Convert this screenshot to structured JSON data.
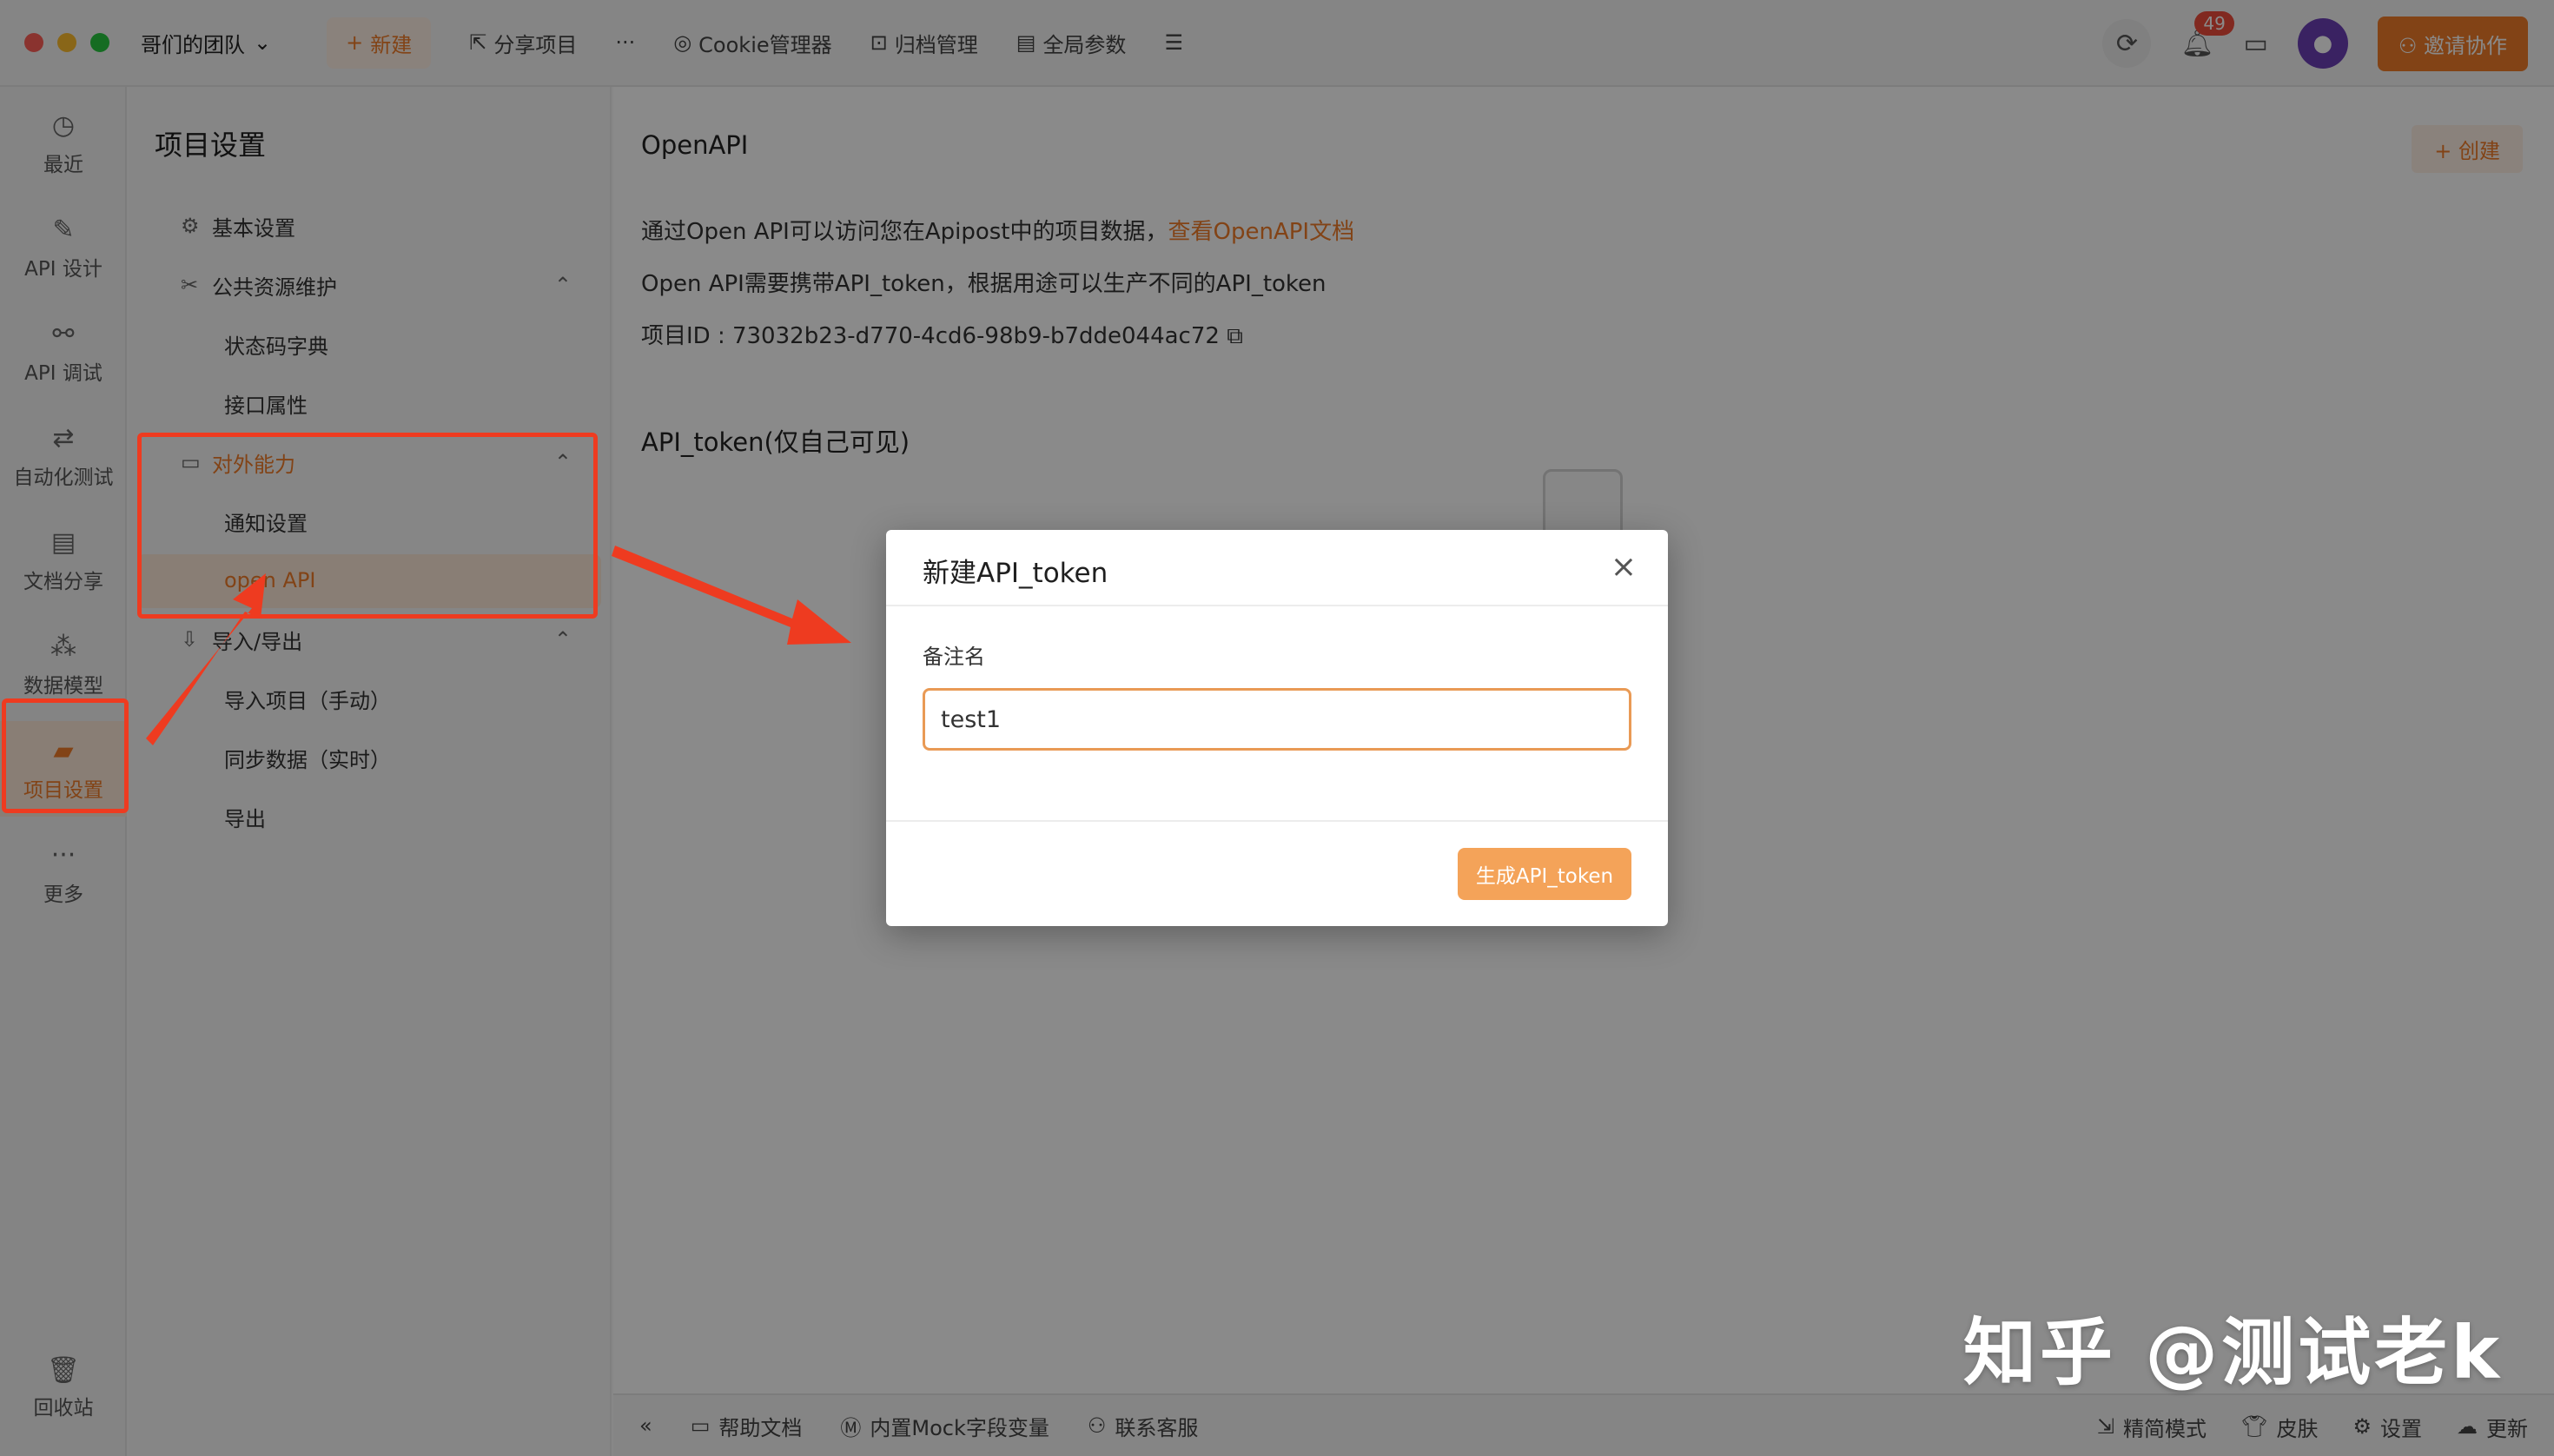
{
  "window": {
    "team": "哥们的团队",
    "toolbar": {
      "new_label": "新建",
      "share_label": "分享项目",
      "more_label": "···",
      "cookie_label": "Cookie管理器",
      "archive_label": "归档管理",
      "global_params_label": "全局参数",
      "notifications_count": "49",
      "invite_label": "邀请协作"
    }
  },
  "leftnav": {
    "items": [
      {
        "label": "最近",
        "icon": "clock-icon"
      },
      {
        "label": "API 设计",
        "icon": "edit-icon"
      },
      {
        "label": "API 调试",
        "icon": "link-icon"
      },
      {
        "label": "自动化测试",
        "icon": "flow-icon"
      },
      {
        "label": "文档分享",
        "icon": "document-icon"
      },
      {
        "label": "数据模型",
        "icon": "model-icon"
      },
      {
        "label": "项目设置",
        "icon": "folder-settings-icon"
      },
      {
        "label": "更多",
        "icon": "more-icon"
      }
    ],
    "trash_label": "回收站"
  },
  "settings": {
    "title": "项目设置",
    "basic": "基本设置",
    "public_resources": "公共资源维护",
    "status_codes": "状态码字典",
    "interface_props": "接口属性",
    "external": "对外能力",
    "notify": "通知设置",
    "openapi": "open API",
    "import_export": "导入/导出",
    "import_project": "导入项目（手动）",
    "sync_data": "同步数据（实时）",
    "export": "导出"
  },
  "main": {
    "title": "OpenAPI",
    "create_label": "创建",
    "desc1": "通过Open API可以访问您在Apipost中的项目数据，",
    "desc1_link": "查看OpenAPI文档",
    "desc2": "Open API需要携带API_token，根据用途可以生产不同的API_token",
    "project_id": "项目ID : 73032b23-d770-4cd6-98b9-b7dde044ac72",
    "token_title": "API_token(仅自己可见)"
  },
  "bottombar": {
    "help": "帮助文档",
    "mock": "内置Mock字段变量",
    "support": "联系客服",
    "simple": "精简模式",
    "skin": "皮肤",
    "settings": "设置",
    "update": "更新"
  },
  "modal": {
    "title": "新建API_token",
    "field_label": "备注名",
    "field_value": "test1",
    "button": "生成API_token"
  },
  "watermark": "知乎 @测试老k",
  "colors": {
    "accent": "#f07d2a",
    "annotation": "#ee3b20"
  }
}
